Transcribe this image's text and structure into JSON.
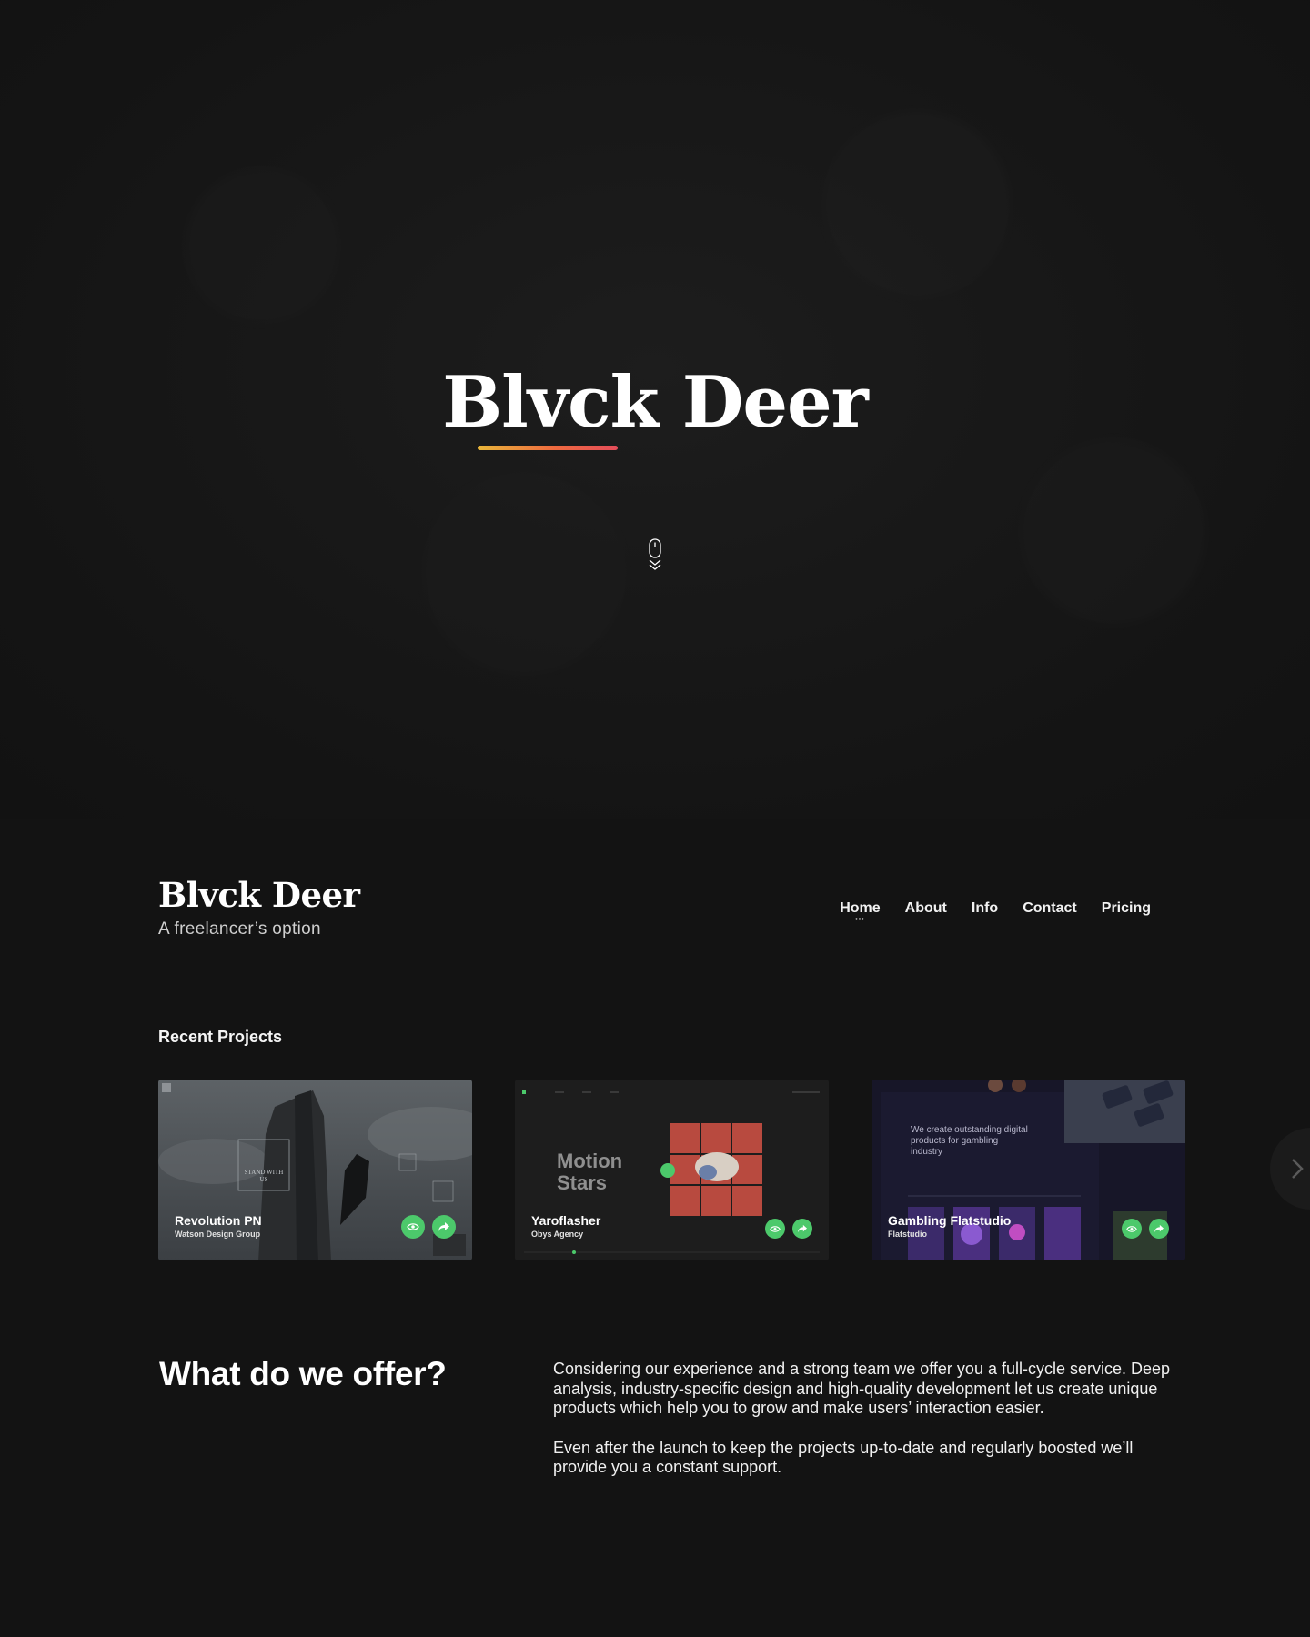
{
  "hero": {
    "title": "Blvck Deer"
  },
  "header": {
    "brand_title": "Blvck Deer",
    "brand_subtitle": "A freelancer’s option",
    "nav": [
      {
        "label": "Home",
        "active": true
      },
      {
        "label": "About",
        "active": false
      },
      {
        "label": "Info",
        "active": false
      },
      {
        "label": "Contact",
        "active": false
      },
      {
        "label": "Pricing",
        "active": false
      }
    ]
  },
  "projects": {
    "heading": "Recent Projects",
    "items": [
      {
        "title": "Revolution PN",
        "client": "Watson Design Group",
        "art_text": "STAND WITH US"
      },
      {
        "title": "Yaroflasher",
        "client": "Obys Agency",
        "art_text": "Motion Stars"
      },
      {
        "title": "Gambling Flatstudio",
        "client": "Flatstudio",
        "art_text": "We create outstanding digital products for gambling industry"
      }
    ]
  },
  "offer": {
    "heading": "What do we offer?",
    "paragraph1": "Considering our experience and a strong team we offer you a full-cycle service. Deep analysis, industry-specific design and high-quality development let us create unique products which help you to grow and make users’ interaction easier.",
    "paragraph2": "Even after the launch to keep the projects up-to-date and regularly boosted we’ll provide you a constant support."
  },
  "colors": {
    "background": "#131313",
    "accent_green": "#4cc96b",
    "underline_start": "#e8b63a",
    "underline_end": "#e44d5a"
  },
  "icons": {
    "scroll": "mouse-scroll-icon",
    "view": "eye-icon",
    "share": "share-arrow-icon",
    "next": "chevron-right-icon"
  }
}
